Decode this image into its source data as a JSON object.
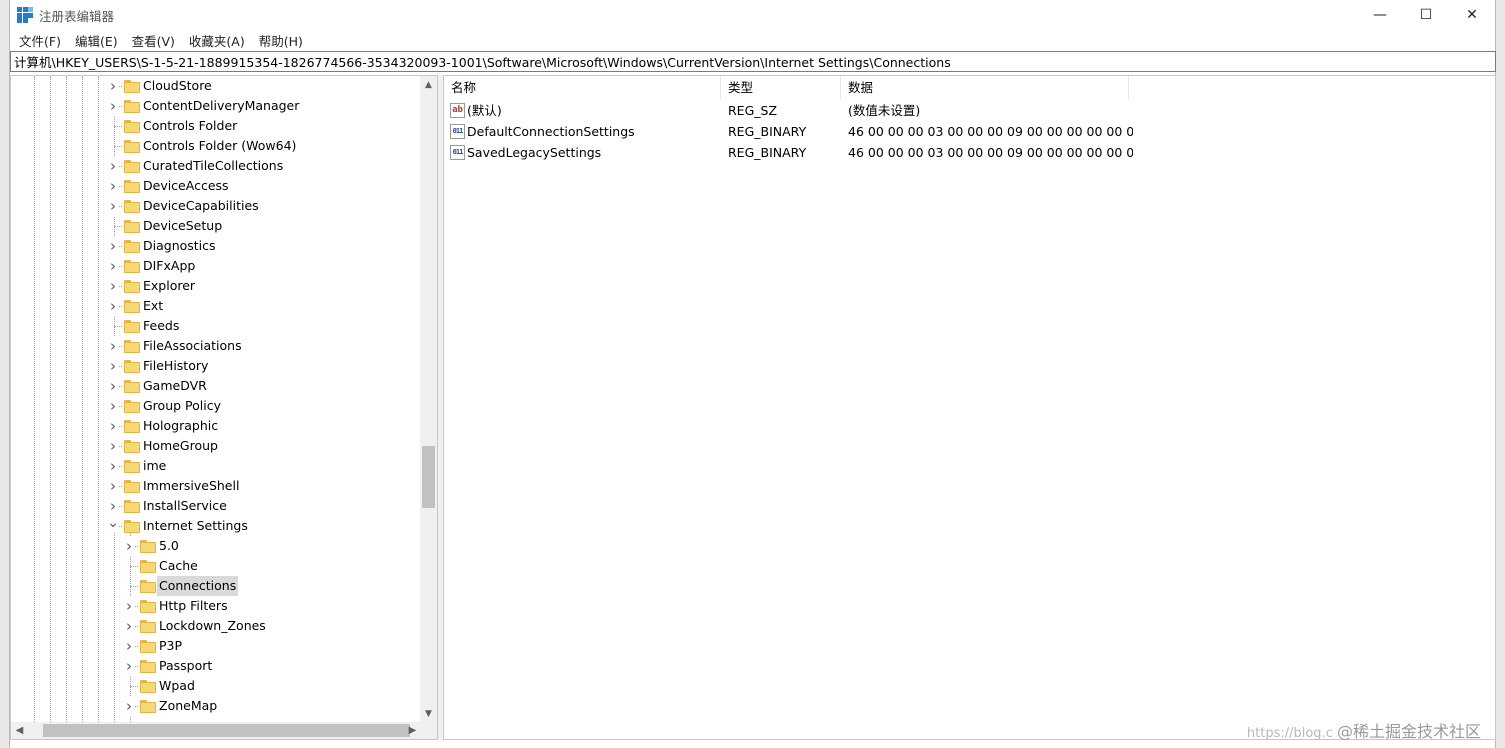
{
  "window": {
    "title": "注册表编辑器",
    "controls": {
      "minimize": "—",
      "maximize": "☐",
      "close": "✕"
    }
  },
  "menu": [
    "文件(F)",
    "编辑(E)",
    "查看(V)",
    "收藏夹(A)",
    "帮助(H)"
  ],
  "address": "计算机\\HKEY_USERS\\S-1-5-21-1889915354-1826774566-3534320093-1001\\Software\\Microsoft\\Windows\\CurrentVersion\\Internet Settings\\Connections",
  "tree": {
    "items": [
      {
        "label": "CloudStore",
        "level": 0,
        "expander": "collapsed"
      },
      {
        "label": "ContentDeliveryManager",
        "level": 0,
        "expander": "collapsed"
      },
      {
        "label": "Controls Folder",
        "level": 0,
        "expander": "none"
      },
      {
        "label": "Controls Folder (Wow64)",
        "level": 0,
        "expander": "none"
      },
      {
        "label": "CuratedTileCollections",
        "level": 0,
        "expander": "collapsed"
      },
      {
        "label": "DeviceAccess",
        "level": 0,
        "expander": "collapsed"
      },
      {
        "label": "DeviceCapabilities",
        "level": 0,
        "expander": "collapsed"
      },
      {
        "label": "DeviceSetup",
        "level": 0,
        "expander": "none"
      },
      {
        "label": "Diagnostics",
        "level": 0,
        "expander": "collapsed"
      },
      {
        "label": "DIFxApp",
        "level": 0,
        "expander": "collapsed"
      },
      {
        "label": "Explorer",
        "level": 0,
        "expander": "collapsed"
      },
      {
        "label": "Ext",
        "level": 0,
        "expander": "collapsed"
      },
      {
        "label": "Feeds",
        "level": 0,
        "expander": "none"
      },
      {
        "label": "FileAssociations",
        "level": 0,
        "expander": "collapsed"
      },
      {
        "label": "FileHistory",
        "level": 0,
        "expander": "collapsed"
      },
      {
        "label": "GameDVR",
        "level": 0,
        "expander": "collapsed"
      },
      {
        "label": "Group Policy",
        "level": 0,
        "expander": "collapsed"
      },
      {
        "label": "Holographic",
        "level": 0,
        "expander": "collapsed"
      },
      {
        "label": "HomeGroup",
        "level": 0,
        "expander": "collapsed"
      },
      {
        "label": "ime",
        "level": 0,
        "expander": "collapsed"
      },
      {
        "label": "ImmersiveShell",
        "level": 0,
        "expander": "collapsed"
      },
      {
        "label": "InstallService",
        "level": 0,
        "expander": "collapsed"
      },
      {
        "label": "Internet Settings",
        "level": 0,
        "expander": "expanded"
      },
      {
        "label": "5.0",
        "level": 1,
        "expander": "collapsed"
      },
      {
        "label": "Cache",
        "level": 1,
        "expander": "none"
      },
      {
        "label": "Connections",
        "level": 1,
        "expander": "none",
        "selected": true
      },
      {
        "label": "Http Filters",
        "level": 1,
        "expander": "collapsed"
      },
      {
        "label": "Lockdown_Zones",
        "level": 1,
        "expander": "collapsed"
      },
      {
        "label": "P3P",
        "level": 1,
        "expander": "collapsed"
      },
      {
        "label": "Passport",
        "level": 1,
        "expander": "collapsed"
      },
      {
        "label": "Wpad",
        "level": 1,
        "expander": "none"
      },
      {
        "label": "ZoneMap",
        "level": 1,
        "expander": "collapsed"
      }
    ]
  },
  "list": {
    "columns": [
      "名称",
      "类型",
      "数据"
    ],
    "rows": [
      {
        "icon": "string-value-icon",
        "name": "(默认)",
        "type": "REG_SZ",
        "data": "(数值未设置)"
      },
      {
        "icon": "binary-value-icon",
        "name": "DefaultConnectionSettings",
        "type": "REG_BINARY",
        "data": "46 00 00 00 03 00 00 00 09 00 00 00 00 00 00..."
      },
      {
        "icon": "binary-value-icon",
        "name": "SavedLegacySettings",
        "type": "REG_BINARY",
        "data": "46 00 00 00 03 00 00 00 09 00 00 00 00 00 00..."
      }
    ]
  },
  "watermark": {
    "url": "https://blog.c",
    "brand": "@稀土掘金技术社区"
  }
}
